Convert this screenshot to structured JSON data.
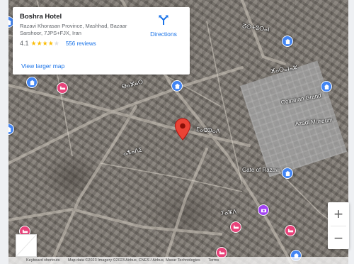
{
  "place": {
    "name": "Boshra Hotel",
    "address": "Razavi Khorasan Province, Mashhad, Bazaar Sarshoor, 7JPS+FJX, Iran",
    "rating": "4.1",
    "stars": 4,
    "reviews": "556 reviews",
    "larger_map": "View larger map",
    "directions": "Directions"
  },
  "zoom": {
    "in": "+",
    "out": "−"
  },
  "street_labels": [
    "ⵒⵙⵜⵓⵔⴰⵏ",
    "ⴼⴰⵔⴰⵏⴰⵣ",
    "ⴱⴰⵣⴰⵔ",
    "ⵎⴰⵛⵀⴰⴷ",
    "ⴰⵣⴰⴷⵉ",
    "ⵢⴰⵣⴷ"
  ],
  "landmarks": [
    "Golrahan Grand",
    "Azadi Museum",
    "Gate of Razavi"
  ],
  "attribution": [
    "Keyboard shortcuts",
    "Map data ©2023 Imagery ©2023 Airbus, CNES / Airbus, Maxar Technologies",
    "Terms"
  ],
  "colors": {
    "link": "#1a73e8",
    "pin": "#ea4335",
    "poi_blue": "#4285f4",
    "poi_pink": "#e8437a",
    "poi_purple": "#a142f4",
    "star": "#fbbc04"
  }
}
